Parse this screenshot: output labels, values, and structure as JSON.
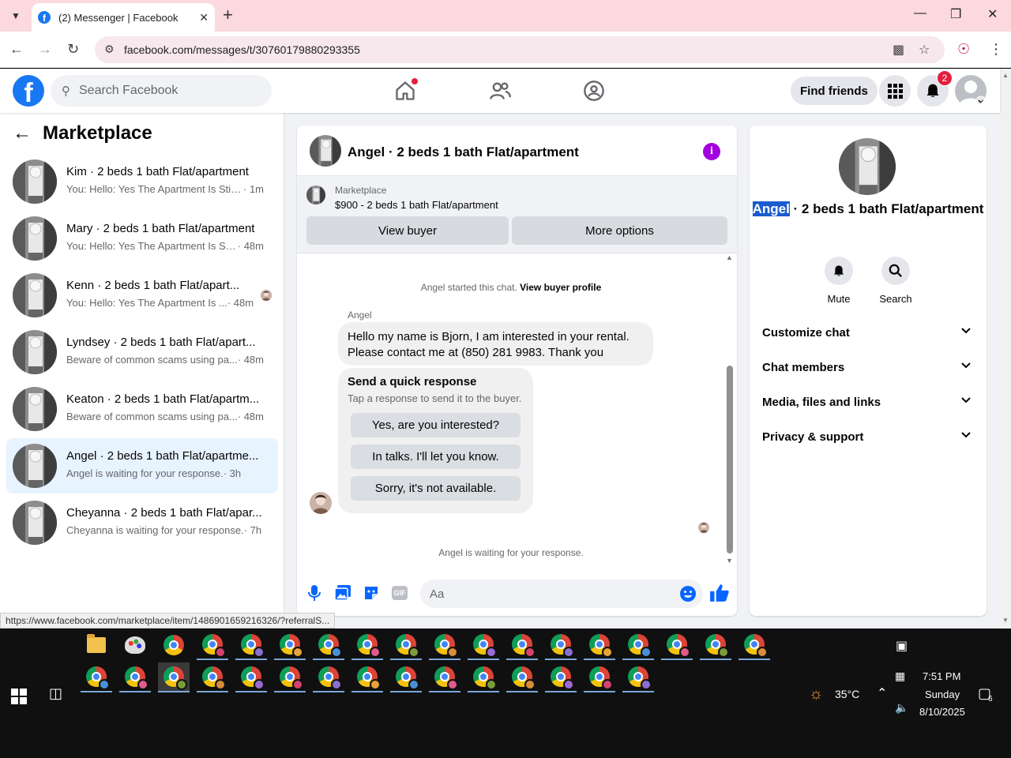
{
  "browser": {
    "tab_title": "(2) Messenger | Facebook",
    "tab_favicon": "f",
    "url": "facebook.com/messages/t/30760179880293355",
    "status_url": "https://www.facebook.com/marketplace/item/1486901659216326/?referralS..."
  },
  "fb_header": {
    "logo": "f",
    "search_placeholder": "Search Facebook",
    "find_friends": "Find friends",
    "notification_count": "2"
  },
  "sidebar": {
    "title": "Marketplace",
    "conversations": [
      {
        "name": "Kim · 2 beds 1 bath Flat/apartment",
        "message": "You: Hello: Yes The Apartment Is Still ...",
        "time": " · 1m"
      },
      {
        "name": "Mary · 2 beds 1 bath Flat/apartment",
        "message": "You: Hello: Yes The Apartment Is Still...",
        "time": " · 48m"
      },
      {
        "name": "Kenn · 2 beds 1 bath Flat/apart...",
        "message": "You: Hello: Yes The Apartment Is ...",
        "time": " · 48m"
      },
      {
        "name": "Lyndsey · 2 beds 1 bath Flat/apart...",
        "message": "Beware of common scams using pa...",
        "time": " · 48m"
      },
      {
        "name": "Keaton · 2 beds 1 bath Flat/apartm...",
        "message": "Beware of common scams using pa...",
        "time": " · 48m"
      },
      {
        "name": "Angel · 2 beds 1 bath Flat/apartme...",
        "message": "Angel is waiting for your response.",
        "time": " · 3h"
      },
      {
        "name": "Cheyanna · 2 beds 1 bath Flat/apar...",
        "message": "Cheyanna is waiting for your response.",
        "time": " · 7h"
      }
    ]
  },
  "chat": {
    "title": "Angel · 2 beds 1 bath Flat/apartment",
    "listing_label": "Marketplace",
    "listing_price": "$900 - 2 beds 1 bath Flat/apartment",
    "view_buyer": "View buyer",
    "more_options": "More options",
    "started_text": "Angel started this chat. ",
    "view_buyer_profile": "View buyer profile",
    "sender": "Angel",
    "message": "Hello my name is Bjorn, I am interested in your rental. Please contact me at (850) 281 9983. Thank you",
    "quick_title": "Send a quick response",
    "quick_subtitle": "Tap a response to send it to the buyer.",
    "quick_replies": [
      "Yes, are you interested?",
      "In talks. I'll let you know.",
      "Sorry, it's not available."
    ],
    "waiting": "Angel is waiting for your response.",
    "input_placeholder": "Aa",
    "gif_label": "GIF"
  },
  "details": {
    "name_highlight": "Angel",
    "name_rest": " · 2 beds 1 bath Flat/apartment",
    "mute": "Mute",
    "search": "Search",
    "sections": [
      "Customize chat",
      "Chat members",
      "Media, files and links",
      "Privacy & support"
    ]
  },
  "taskbar": {
    "temperature": "35°C",
    "time": "7:51 PM",
    "day": "Sunday",
    "date": "8/10/2025",
    "notification_count": "6"
  },
  "colors": {
    "fb_blue": "#1877f2",
    "active_conv": "#e7f3ff",
    "info_purple": "#a300e0",
    "badge_red": "#e41e3f"
  }
}
